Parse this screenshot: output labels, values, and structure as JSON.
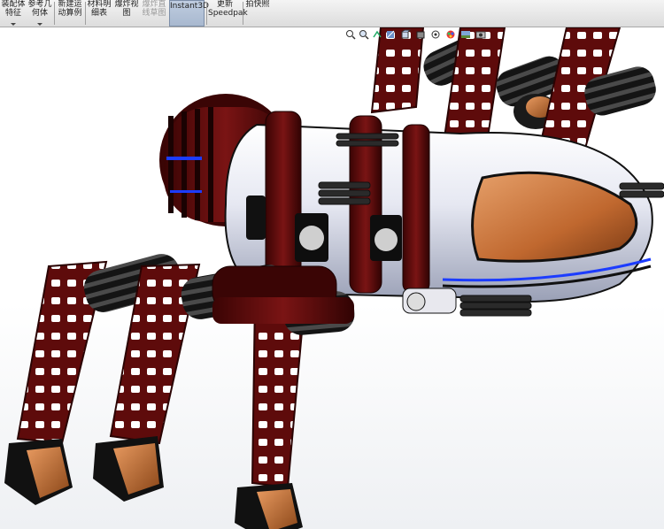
{
  "ribbon": {
    "buttons": [
      {
        "line1": "装配体",
        "line2": "特征",
        "dropdown": true,
        "dim": false
      },
      {
        "line1": "参考几",
        "line2": "何体",
        "dropdown": true,
        "dim": false
      },
      {
        "line1": "新建运",
        "line2": "动算例",
        "dropdown": false,
        "dim": false
      },
      {
        "line1": "材料明",
        "line2": "细表",
        "dropdown": false,
        "dim": false
      },
      {
        "line1": "爆炸视",
        "line2": "图",
        "dropdown": false,
        "dim": false
      },
      {
        "line1": "爆炸直",
        "line2": "线草图",
        "dropdown": false,
        "dim": true
      },
      {
        "line1": "Instant3D",
        "line2": "",
        "dropdown": false,
        "dim": false
      },
      {
        "line1": "更新",
        "line2": "Speedpak",
        "dropdown": false,
        "dim": false
      },
      {
        "line1": "拍快照",
        "line2": "",
        "dropdown": false,
        "dim": false
      }
    ]
  },
  "view_toolbar": {
    "icons": [
      "zoom-to-fit-icon",
      "zoom-to-area-icon",
      "previous-view-icon",
      "section-view-icon",
      "view-orientation-icon",
      "display-style-icon",
      "hide-show-items-icon",
      "edit-appearance-icon",
      "apply-scene-icon",
      "view-settings-icon"
    ]
  },
  "colors": {
    "frame_red": "#5a0a0a",
    "hull_white": "#eef0f6",
    "canopy_orange": "#c8703a",
    "accent_blue": "#1c3cff",
    "dark_grey": "#2a2a2a"
  }
}
